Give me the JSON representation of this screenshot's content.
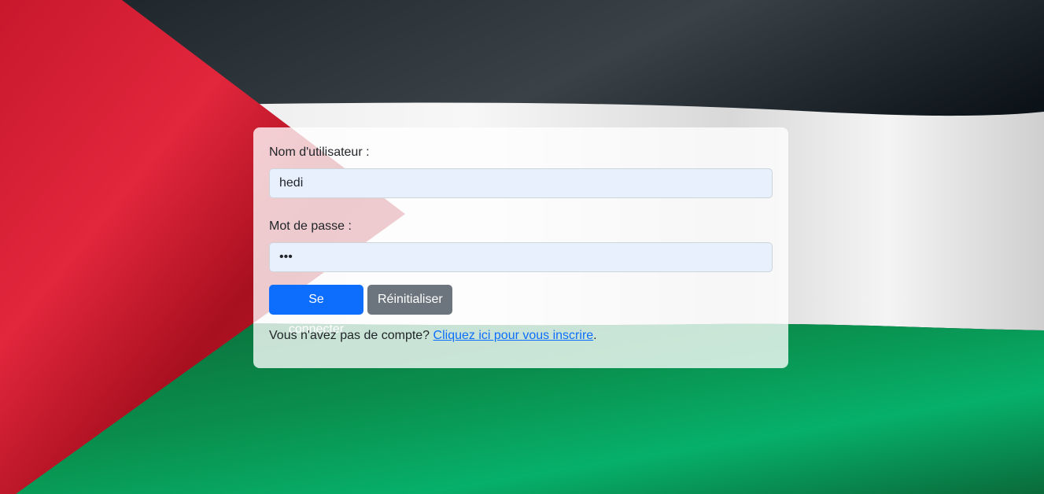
{
  "background": {
    "description_icon": "flag-icon",
    "colors": {
      "black": "#0a0f14",
      "white": "#f2f2f2",
      "green": "#0a8a4a",
      "red": "#d81e34"
    }
  },
  "form": {
    "username_label": "Nom d'utilisateur :",
    "username_value": "hedi",
    "password_label": "Mot de passe :",
    "password_value": "•••",
    "submit_label": "Se connecter",
    "reset_label": "Réinitialiser",
    "signup_prefix": "Vous n'avez pas de compte? ",
    "signup_link": "Cliquez ici pour vous inscrire",
    "signup_suffix": "."
  },
  "colors": {
    "primary": "#0d6efd",
    "secondary": "#6c757d",
    "input_bg": "#e8f0fe"
  }
}
